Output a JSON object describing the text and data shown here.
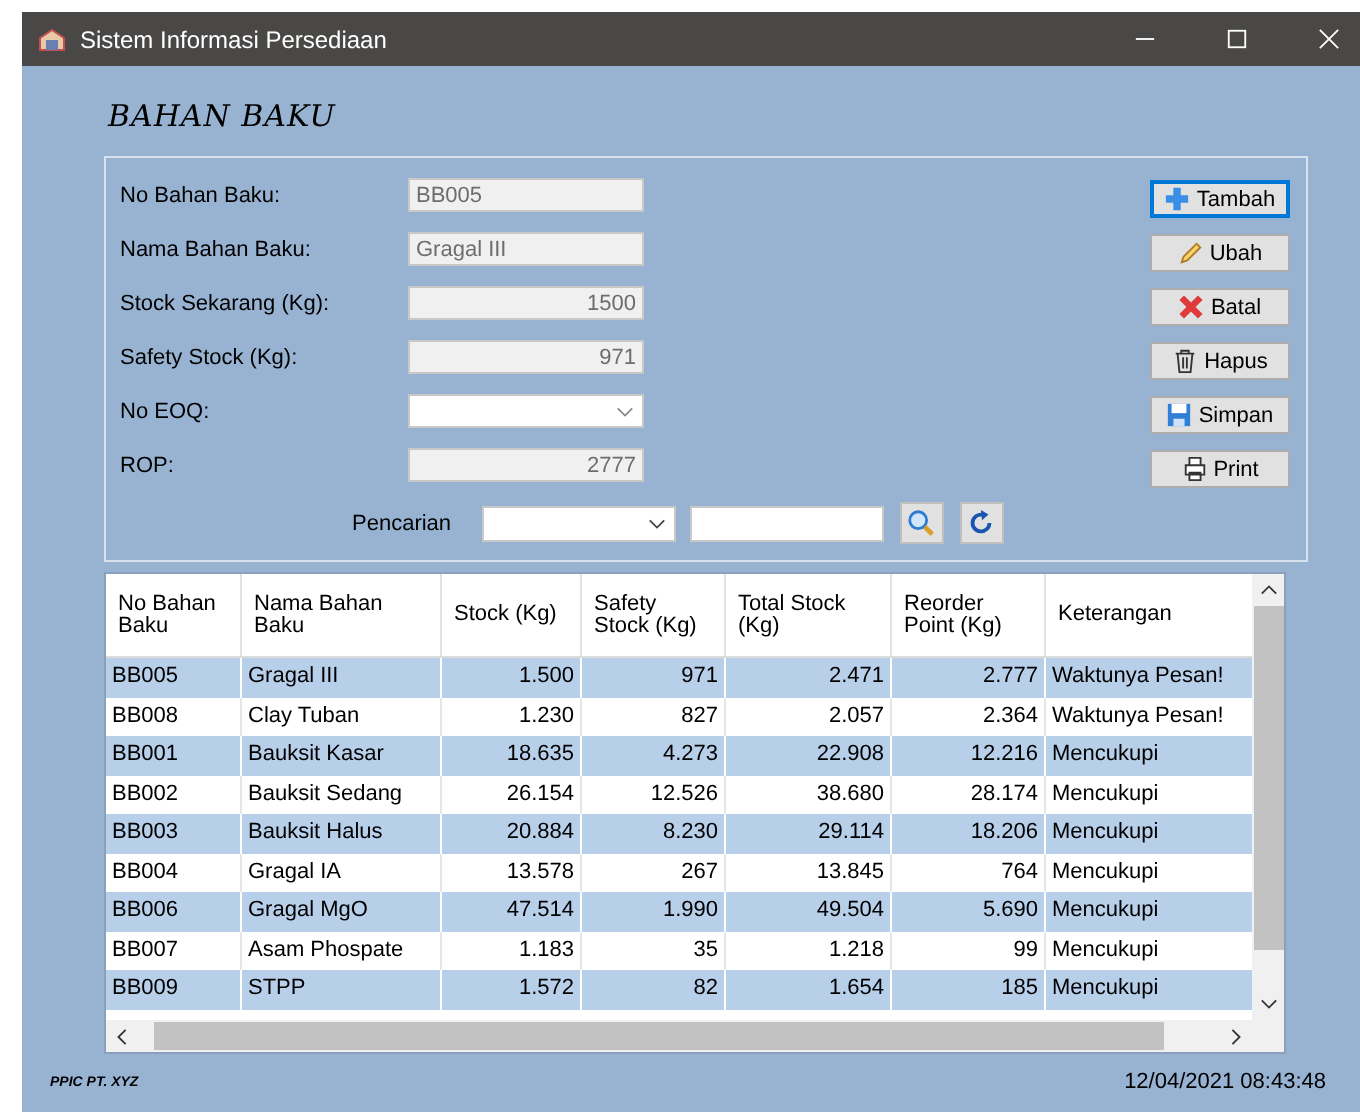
{
  "window": {
    "title": "Sistem Informasi Persediaan"
  },
  "heading": "BAHAN BAKU",
  "fields": [
    {
      "label": "No Bahan Baku:",
      "kind": "text",
      "value": "BB005"
    },
    {
      "label": "Nama Bahan Baku:",
      "kind": "text",
      "value": "Gragal III"
    },
    {
      "label": "Stock Sekarang (Kg):",
      "kind": "number",
      "value": "1500"
    },
    {
      "label": "Safety Stock (Kg):",
      "kind": "number",
      "value": "971"
    },
    {
      "label": "No EOQ:",
      "kind": "combo"
    },
    {
      "label": "ROP:",
      "kind": "number",
      "value": "2777"
    }
  ],
  "buttons": [
    {
      "label": "Tambah",
      "kind": "add",
      "focused": true
    },
    {
      "label": "Ubah",
      "kind": "edit",
      "focused": false
    },
    {
      "label": "Batal",
      "kind": "cancel",
      "focused": false
    },
    {
      "label": "Hapus",
      "kind": "delete",
      "focused": false
    },
    {
      "label": "Simpan",
      "kind": "save",
      "focused": false
    },
    {
      "label": "Print",
      "kind": "print",
      "focused": false
    }
  ],
  "search": {
    "label": "Pencarian"
  },
  "table": {
    "columns": [
      {
        "title": "No Bahan Baku",
        "kind": "text"
      },
      {
        "title": "Nama Bahan Baku",
        "kind": "text"
      },
      {
        "title": "Stock (Kg)",
        "kind": "number"
      },
      {
        "title": "Safety Stock (Kg)",
        "kind": "number"
      },
      {
        "title": "Total Stock (Kg)",
        "kind": "number"
      },
      {
        "title": "Reorder Point (Kg)",
        "kind": "number"
      },
      {
        "title": "Keterangan",
        "kind": "text"
      }
    ],
    "rows": [
      [
        "BB005",
        "Gragal III",
        "1.500",
        "971",
        "2.471",
        "2.777",
        "Waktunya Pesan!"
      ],
      [
        "BB008",
        "Clay Tuban",
        "1.230",
        "827",
        "2.057",
        "2.364",
        "Waktunya Pesan!"
      ],
      [
        "BB001",
        "Bauksit Kasar",
        "18.635",
        "4.273",
        "22.908",
        "12.216",
        "Mencukupi"
      ],
      [
        "BB002",
        "Bauksit Sedang",
        "26.154",
        "12.526",
        "38.680",
        "28.174",
        "Mencukupi"
      ],
      [
        "BB003",
        "Bauksit Halus",
        "20.884",
        "8.230",
        "29.114",
        "18.206",
        "Mencukupi"
      ],
      [
        "BB004",
        "Gragal IA",
        "13.578",
        "267",
        "13.845",
        "764",
        "Mencukupi"
      ],
      [
        "BB006",
        "Gragal MgO",
        "47.514",
        "1.990",
        "49.504",
        "5.690",
        "Mencukupi"
      ],
      [
        "BB007",
        "Asam Phospate",
        "1.183",
        "35",
        "1.218",
        "99",
        "Mencukupi"
      ],
      [
        "BB009",
        "STPP",
        "1.572",
        "82",
        "1.654",
        "185",
        "Mencukupi"
      ]
    ]
  },
  "status_bar": {
    "company": "PPIC PT. XYZ",
    "datetime": "12/04/2021 08:43:48"
  }
}
